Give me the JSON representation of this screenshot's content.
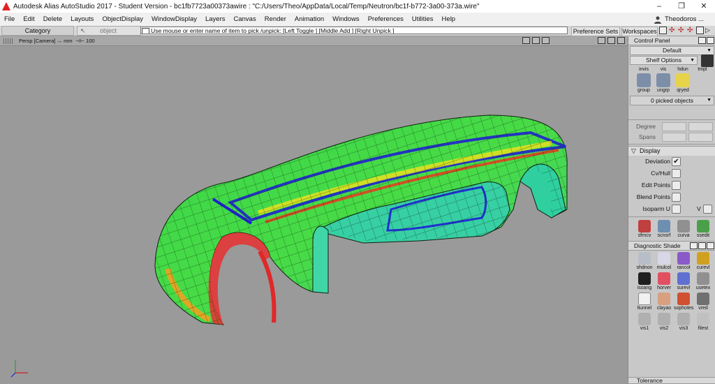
{
  "window": {
    "title": "Autodesk Alias AutoStudio 2017  - Student Version   - bc1fb7723a00373awire : \"C:/Users/Theo/AppData/Local/Temp/Neutron/bc1f-b772-3a00-373a.wire\"",
    "controls": [
      "–",
      "❐",
      "✕"
    ]
  },
  "menu": {
    "items": [
      "File",
      "Edit",
      "Delete",
      "Layouts",
      "ObjectDisplay",
      "WindowDisplay",
      "Layers",
      "Canvas",
      "Render",
      "Animation",
      "Windows",
      "Preferences",
      "Utilities",
      "Help"
    ],
    "user": "Theodoros ..."
  },
  "toolbar": {
    "category": "Category",
    "object": "object",
    "prompt": "Use mouse or enter name of item to pick /unpick: [Left Toggle ] [Middle Add ] [Right Unpick ]",
    "preference_sets": "Preference Sets",
    "workspaces": "Workspaces"
  },
  "viewport": {
    "label": "Persp [Camera] ↔ mm",
    "scale": "100"
  },
  "panel": {
    "title": "Control Panel",
    "dropdown1": "Default",
    "dropdown2": "Shelf Options",
    "shelf_top": [
      {
        "label": "invis",
        "icon": "invisible-icon",
        "color": "#8a8a8a"
      },
      {
        "label": "vis",
        "icon": "visible-icon",
        "color": "#8a8a8a"
      },
      {
        "label": "hdun",
        "icon": "hide-unselected-icon",
        "color": "#8a8a8a"
      },
      {
        "label": "tmpl",
        "icon": "template-icon",
        "color": "#8a8a8a"
      }
    ],
    "shelf_second": [
      {
        "label": "group",
        "icon": "group-icon",
        "color": "#7d8fa8"
      },
      {
        "label": "ungrp",
        "icon": "ungroup-icon",
        "color": "#7d8fa8"
      },
      {
        "label": "qryed",
        "icon": "query-edit-icon",
        "color": "#e6d34a"
      }
    ],
    "picked": "0 picked objects",
    "degree_label": "Degree",
    "spans_label": "Spans",
    "display_header": "Display",
    "display": [
      {
        "label": "Deviation",
        "checked": true
      },
      {
        "label": "Cv/Hull",
        "checked": false
      },
      {
        "label": "Edit Points",
        "checked": false
      },
      {
        "label": "Blend Points",
        "checked": false
      },
      {
        "label": "Isoparm U",
        "checked": false
      }
    ],
    "isoparm_v": "V",
    "tools_row": [
      {
        "label": "sfrncv",
        "icon": "surface-curve-icon",
        "color": "#c04040"
      },
      {
        "label": "scnsrf",
        "icon": "scan-surface-icon",
        "color": "#6f8fb0"
      },
      {
        "label": "curva",
        "icon": "curvature-icon",
        "color": "#909090"
      },
      {
        "label": "ssedit",
        "icon": "surface-edit-icon",
        "color": "#4aa04a"
      }
    ],
    "diag_title": "Diagnostic Shade",
    "diag_tools": [
      {
        "label": "shdnon",
        "icon": "shade-none-icon",
        "color": "#b8bec8"
      },
      {
        "label": "mulcol",
        "icon": "multicolor-icon",
        "color": "#d7d7e8"
      },
      {
        "label": "rancol",
        "icon": "random-color-icon",
        "color": "#8a5ac8"
      },
      {
        "label": "curevl",
        "icon": "curvature-eval-icon",
        "color": "#d0a020"
      },
      {
        "label": "isoang",
        "icon": "isoangle-icon",
        "color": "#202020"
      },
      {
        "label": "horver",
        "icon": "horizontal-vertical-icon",
        "color": "#e05060"
      },
      {
        "label": "surevl",
        "icon": "surface-eval-icon",
        "color": "#6070d0"
      },
      {
        "label": "usetex",
        "icon": "use-texture-icon",
        "color": "#909090"
      },
      {
        "label": "ltunnel",
        "icon": "light-tunnel-icon",
        "color": "#f0f0f0"
      },
      {
        "label": "clayao",
        "icon": "clay-ao-icon",
        "color": "#d8a080"
      },
      {
        "label": "sophotes",
        "icon": "isophotes-icon",
        "color": "#d05030"
      },
      {
        "label": "vred",
        "icon": "vred-icon",
        "color": "#707070"
      },
      {
        "label": "vis1",
        "icon": "vis1-icon",
        "color": "#b0b0b0"
      },
      {
        "label": "vis2",
        "icon": "vis2-icon",
        "color": "#b0b0b0"
      },
      {
        "label": "vis3",
        "icon": "vis3-icon",
        "color": "#b0b0b0"
      },
      {
        "label": "filest",
        "icon": "file-settings-icon",
        "color": "#c0c0c0"
      }
    ],
    "tolerance": "Tolerance"
  }
}
